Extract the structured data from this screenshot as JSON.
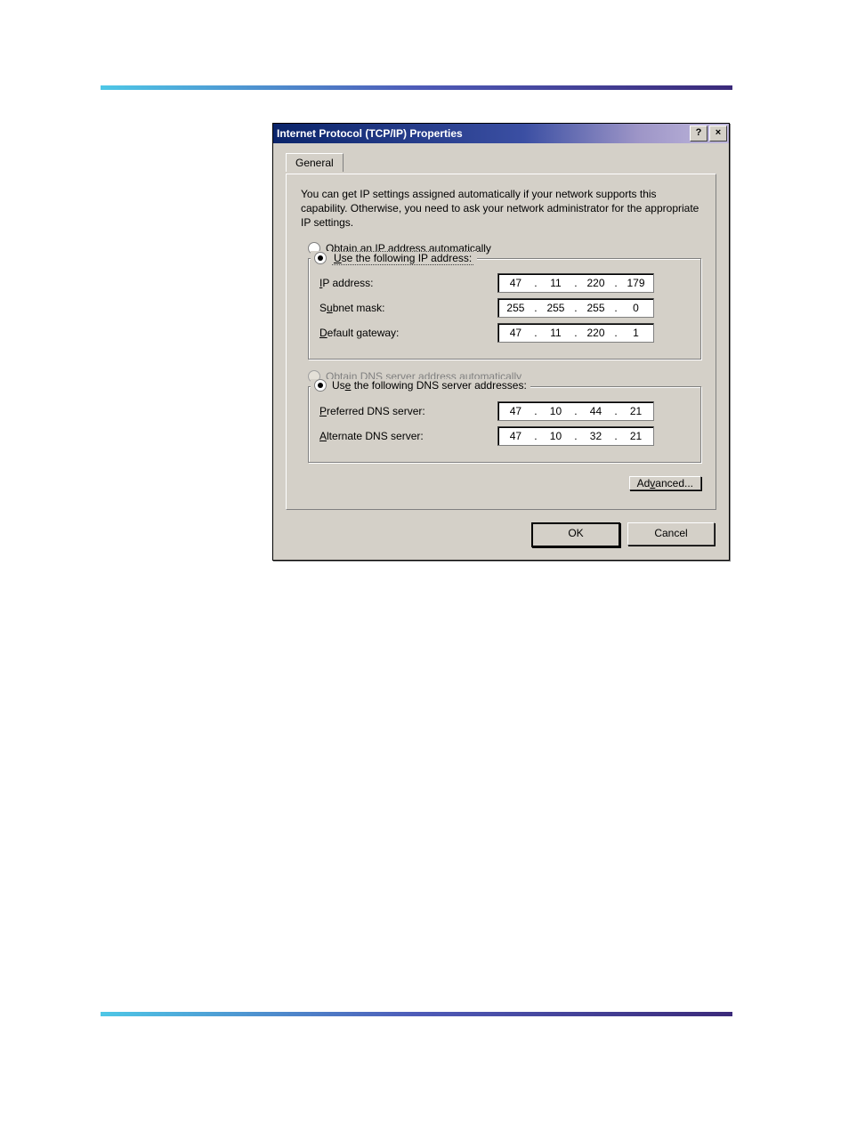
{
  "dialog": {
    "title": "Internet Protocol (TCP/IP) Properties",
    "help_btn": "?",
    "close_btn": "×",
    "tab_general": "General",
    "intro": "You can get IP settings assigned automatically if your network supports this capability. Otherwise, you need to ask your network administrator for the appropriate IP settings.",
    "ip_auto_label_pre": "O",
    "ip_auto_label_letter": "b",
    "ip_auto_label_post": "tain an IP address automatically",
    "ip_manual_label_pre": "U",
    "ip_manual_label_post": "se the following IP address:",
    "ip_address_label_pre": "I",
    "ip_address_label_post": "P address:",
    "subnet_label_pre": "S",
    "subnet_label_letter": "u",
    "subnet_label_post": "bnet mask:",
    "gateway_label_pre": "D",
    "gateway_label_post": "efault gateway:",
    "dns_auto_label_pre": "O",
    "dns_auto_label_letter": "b",
    "dns_auto_label_post": "tain DNS server address automatically",
    "dns_manual_label_pre": "Us",
    "dns_manual_label_letter": "e",
    "dns_manual_label_post": " the following DNS server addresses:",
    "pref_dns_label_pre": "P",
    "pref_dns_label_post": "referred DNS server:",
    "alt_dns_label_pre": "A",
    "alt_dns_label_post": "lternate DNS server:",
    "advanced_pre": "Ad",
    "advanced_letter": "v",
    "advanced_post": "anced...",
    "ok": "OK",
    "cancel": "Cancel",
    "ip": {
      "o1": "47",
      "o2": "11",
      "o3": "220",
      "o4": "179"
    },
    "mask": {
      "o1": "255",
      "o2": "255",
      "o3": "255",
      "o4": "0"
    },
    "gw": {
      "o1": "47",
      "o2": "11",
      "o3": "220",
      "o4": "1"
    },
    "dns1": {
      "o1": "47",
      "o2": "10",
      "o3": "44",
      "o4": "21"
    },
    "dns2": {
      "o1": "47",
      "o2": "10",
      "o3": "32",
      "o4": "21"
    }
  }
}
